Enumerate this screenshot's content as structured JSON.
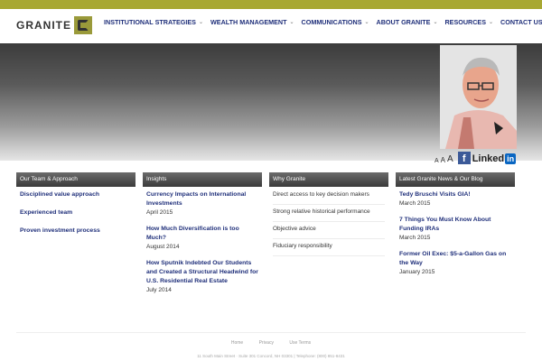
{
  "brand": {
    "logo_text": "GRANITE",
    "accent": "#a8a832"
  },
  "nav": {
    "items": [
      {
        "label": "INSTITUTIONAL STRATEGIES"
      },
      {
        "label": "WEALTH MANAGEMENT"
      },
      {
        "label": "COMMUNICATIONS"
      },
      {
        "label": "ABOUT GRANITE"
      },
      {
        "label": "RESOURCES"
      },
      {
        "label": "CONTACT US"
      }
    ],
    "link_color": "#1f2f7a"
  },
  "toolbar": {
    "font_small": "A",
    "font_medium": "A",
    "font_large": "A",
    "facebook_glyph": "f",
    "linkedin_text": "Linked",
    "linkedin_in": "in"
  },
  "columns": {
    "team": {
      "title": "Our Team & Approach",
      "links": [
        "Disciplined value approach",
        "Experienced team",
        "Proven investment process"
      ]
    },
    "insights": {
      "title": "Insights",
      "posts": [
        {
          "title": "Currency Impacts on International Investments",
          "date": "April 2015"
        },
        {
          "title": "How Much Diversification is too Much?",
          "date": "August 2014"
        },
        {
          "title": "How Sputnik Indebted Our Students and Created a Structural Headwind for U.S. Residential Real Estate",
          "date": "July 2014"
        }
      ]
    },
    "why": {
      "title": "Why Granite",
      "items": [
        "Direct access to key decision makers",
        "Strong relative historical performance",
        "Objective advice",
        "Fiduciary responsibility"
      ]
    },
    "news": {
      "title": "Latest Granite News & Our Blog",
      "posts": [
        {
          "title": "Tedy Bruschi Visits GIA!",
          "date": "March 2015"
        },
        {
          "title": "7 Things You Must Know About Funding IRAs",
          "date": "March 2015"
        },
        {
          "title": "Former Oil Exec: $5-a-Gallon Gas on the Way",
          "date": "January 2015"
        }
      ]
    }
  },
  "footer": {
    "links": [
      "Home",
      "Privacy",
      "Use Terms"
    ],
    "address": "11 South Main Street · Suite 301 Concord, NH 03301 | Telephone: (800) 851-8431"
  }
}
